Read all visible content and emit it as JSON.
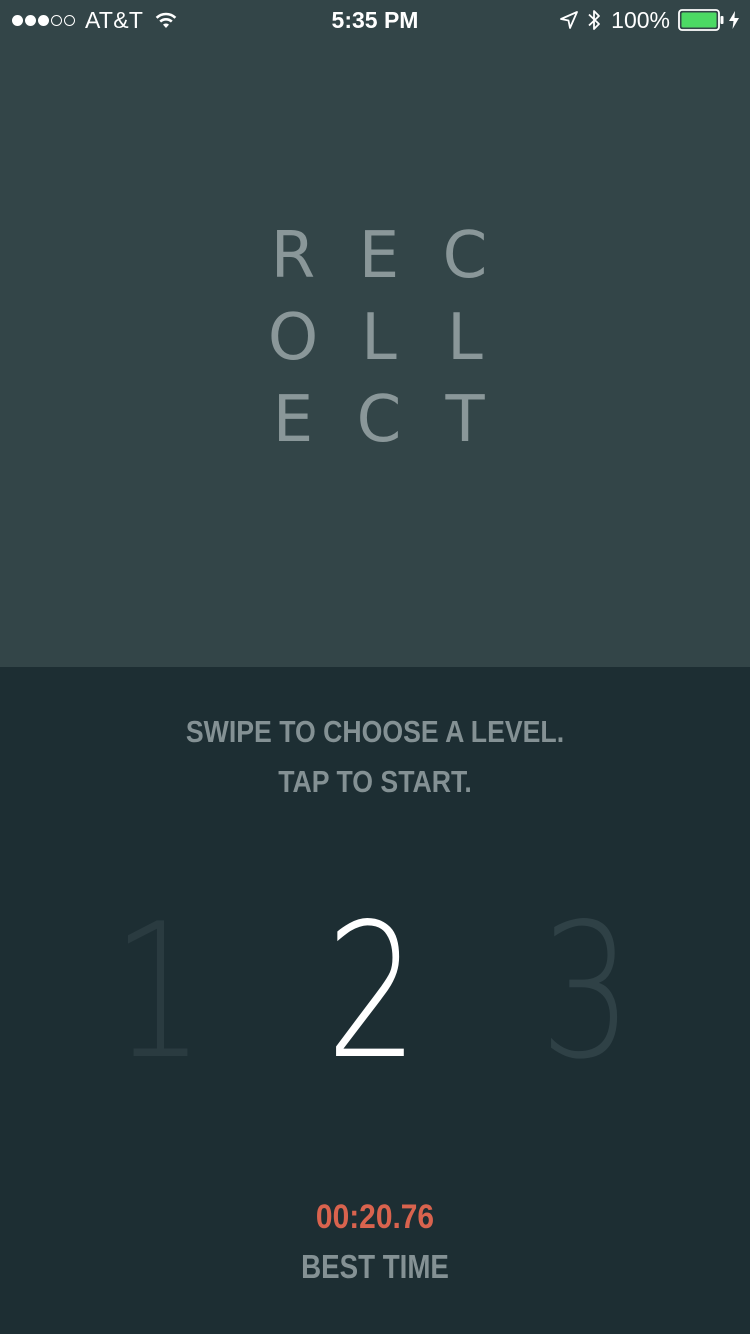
{
  "status_bar": {
    "signal": {
      "filled": 3,
      "total": 5
    },
    "carrier": "AT&T",
    "time": "5:35 PM",
    "battery_percent": "100%",
    "icons": [
      "wifi-icon",
      "location-arrow-icon",
      "bluetooth-icon",
      "battery-icon",
      "charging-bolt-icon"
    ]
  },
  "logo": {
    "rows": [
      [
        "R",
        "E",
        "C"
      ],
      [
        "O",
        "L",
        "L"
      ],
      [
        "E",
        "C",
        "T"
      ]
    ]
  },
  "instructions": {
    "line1": "SWIPE TO CHOOSE A LEVEL.",
    "line2": "TAP TO START."
  },
  "levels": {
    "items": [
      "1",
      "2",
      "3"
    ],
    "selected": "2"
  },
  "best_time": {
    "value": "00:20.76",
    "label": "BEST TIME"
  },
  "colors": {
    "top_panel": "#334548",
    "bottom_panel": "#1d2e33",
    "logo_text": "#8a9799",
    "instruction_text": "#849194",
    "selected_level": "#ffffff",
    "best_time_value": "#d9634e"
  }
}
